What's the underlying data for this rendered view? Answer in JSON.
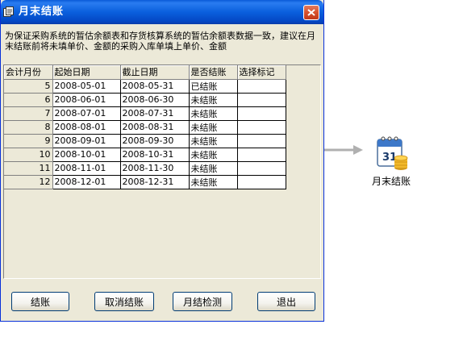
{
  "window": {
    "title": "月末结账"
  },
  "description": "为保证采购系统的暂估余额表和存货核算系统的暂估余额表数据一致，建议在月末结账前将未填单价、金额的采购入库单填上单价、金额",
  "grid": {
    "columns": [
      "会计月份",
      "起始日期",
      "截止日期",
      "是否结账",
      "选择标记"
    ],
    "rows": [
      {
        "month": "5",
        "start": "2008-05-01",
        "end": "2008-05-31",
        "status": "已结账",
        "mark": ""
      },
      {
        "month": "6",
        "start": "2008-06-01",
        "end": "2008-06-30",
        "status": "未结账",
        "mark": ""
      },
      {
        "month": "7",
        "start": "2008-07-01",
        "end": "2008-07-31",
        "status": "未结账",
        "mark": ""
      },
      {
        "month": "8",
        "start": "2008-08-01",
        "end": "2008-08-31",
        "status": "未结账",
        "mark": ""
      },
      {
        "month": "9",
        "start": "2008-09-01",
        "end": "2008-09-30",
        "status": "未结账",
        "mark": ""
      },
      {
        "month": "10",
        "start": "2008-10-01",
        "end": "2008-10-31",
        "status": "未结账",
        "mark": ""
      },
      {
        "month": "11",
        "start": "2008-11-01",
        "end": "2008-11-30",
        "status": "未结账",
        "mark": ""
      },
      {
        "month": "12",
        "start": "2008-12-01",
        "end": "2008-12-31",
        "status": "未结账",
        "mark": ""
      }
    ]
  },
  "buttons": {
    "settle": "结账",
    "cancel": "取消结账",
    "check": "月结检测",
    "exit": "退出"
  },
  "desktop_icon": {
    "label": "月末结账",
    "calendar_day": "31",
    "icon": "calendar-icon"
  },
  "colors": {
    "titlebar": "#0a5fdd",
    "window_bg": "#ece9d8",
    "close_button": "#d6512e",
    "arrow": "#b0b0b0"
  }
}
